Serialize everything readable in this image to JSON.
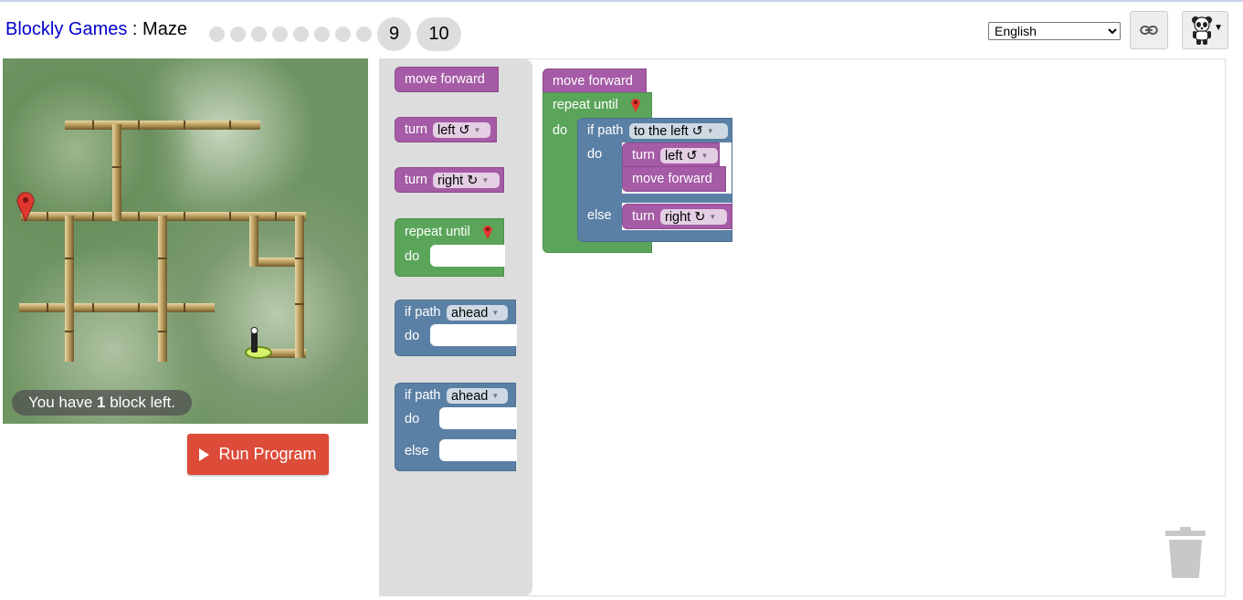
{
  "header": {
    "app_name": "Blockly Games",
    "separator": " : ",
    "game_name": "Maze",
    "levels": {
      "completed_dots": 8,
      "current": "9",
      "next": "10"
    },
    "language": {
      "selected": "English"
    }
  },
  "icons": {
    "link": "link-icon",
    "avatar": "panda-icon",
    "menu_caret": "caret-down-icon",
    "run": "play-icon",
    "trash": "trash-icon",
    "marker": "map-marker-icon",
    "player": "pegman-icon"
  },
  "maze": {
    "status_prefix": "You have ",
    "status_count": "1",
    "status_suffix": " block left."
  },
  "run_button": {
    "label": "Run Program"
  },
  "toolbox": {
    "move_forward": "move forward",
    "turn_left": {
      "label": "turn",
      "option": "left ↺"
    },
    "turn_right": {
      "label": "turn",
      "option": "right ↻"
    },
    "repeat_until": {
      "label": "repeat until",
      "do": "do"
    },
    "if_path": {
      "label": "if path",
      "option": "ahead",
      "do": "do"
    },
    "if_else": {
      "label": "if path",
      "option": "ahead",
      "do": "do",
      "else": "else"
    }
  },
  "program": {
    "move_forward": "move forward",
    "repeat_until": "repeat until",
    "do": "do",
    "if_label": "if path",
    "if_option": "to the left ↺",
    "if_do": "do",
    "turn_label": "turn",
    "turn_left_option": "left ↺",
    "move_forward_inner": "move forward",
    "else": "else",
    "turn_right_label": "turn",
    "turn_right_option": "right ↻"
  },
  "colors": {
    "motion": "#a55ba5",
    "loop": "#5ba55b",
    "logic": "#5b80a5",
    "run": "#dd4b39",
    "title_link": "#0000cc"
  }
}
